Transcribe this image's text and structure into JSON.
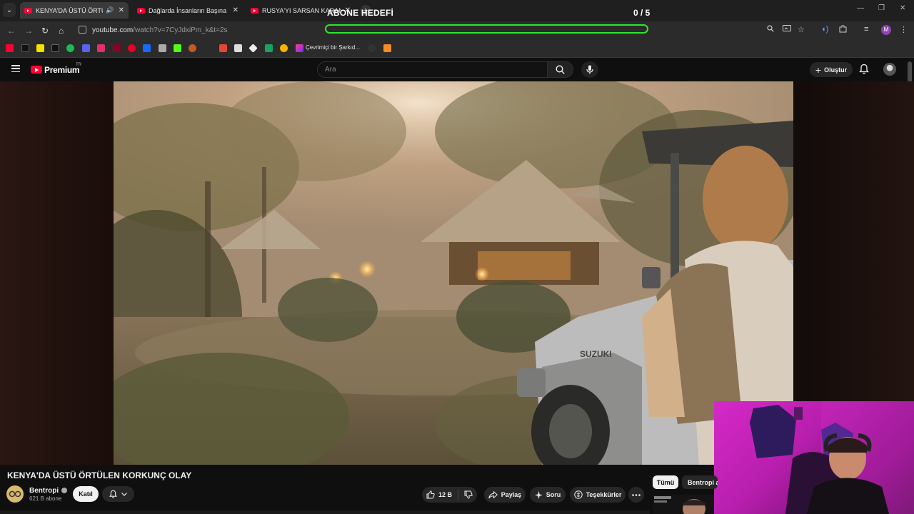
{
  "browser": {
    "tabs": [
      {
        "title": "KENYA'DA ÜSTÜ ÖRTÜLEN",
        "audio": "🔊",
        "close": "✕"
      },
      {
        "title": "Dağlarda İnsanların Başına Gele",
        "close": "✕"
      },
      {
        "title": "RUSYA'YI SARSAN KARANLIK",
        "close": "✕"
      }
    ],
    "url_host": "youtube.com",
    "url_path": "/watch?v=7CyJdxiPm_k&t=2s",
    "bookmark_label": "Çevrimiçi bir Şarkıd..."
  },
  "stream_overlay": {
    "goal_title": "ABONE HEDEFİ",
    "goal_count": "0 / 5",
    "goal_progress": 0,
    "bar_color": "#2ee62e"
  },
  "youtube": {
    "logo_text": "Premium",
    "logo_region": "TR",
    "search_placeholder": "Ara",
    "create_label": "Oluştur"
  },
  "video": {
    "title": "KENYA'DA ÜSTÜ ÖRTÜLEN KORKUNÇ OLAY",
    "channel_name": "Bentropi",
    "subscribers": "621 B abone",
    "join_label": "Katıl",
    "likes": "12 B",
    "share_label": "Paylaş",
    "ask_label": "Soru",
    "thanks_label": "Teşekkürler",
    "jeep_text": "SUZUKI"
  },
  "sidebar_chips": {
    "all": "Tümü",
    "channel": "Bentropi a"
  },
  "colors": {
    "yt_red": "#ff0033",
    "accent_green": "#2ee62e",
    "webcam_pink": "#d629c8"
  }
}
